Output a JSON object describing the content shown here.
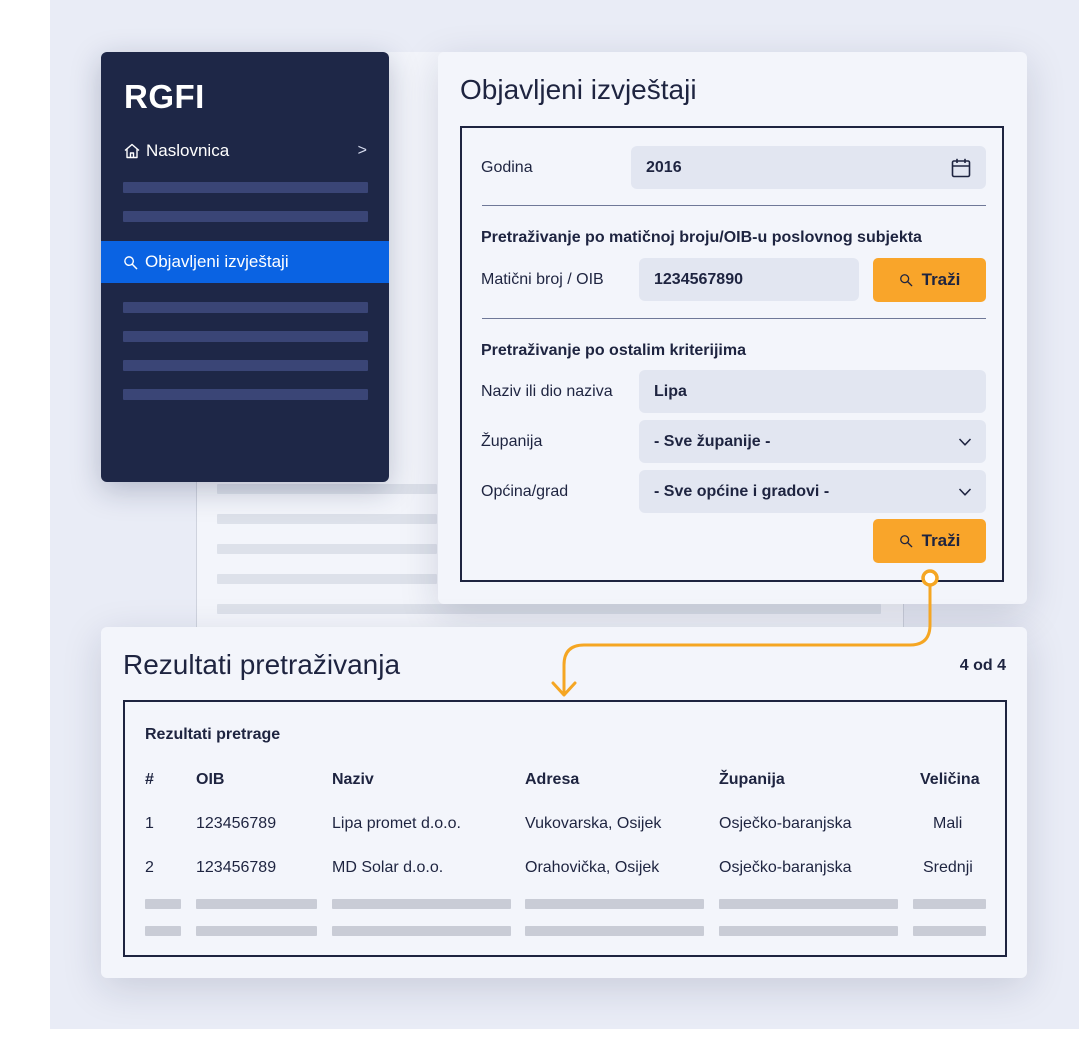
{
  "sidebar": {
    "brand": "RGFI",
    "home_label": "Naslovnica",
    "home_chevron": ">",
    "active_label": "Objavljeni izvještaji"
  },
  "search": {
    "title": "Objavljeni izvještaji",
    "year_label": "Godina",
    "year_value": "2016",
    "section_oib": "Pretraživanje po matičnoj broju/OIB-u poslovnog subjekta",
    "oib_label": "Matični broj / OIB",
    "oib_value": "1234567890",
    "search_button": "Traži",
    "section_other": "Pretraživanje po ostalim kriterijima",
    "name_label": "Naziv ili dio naziva",
    "name_value": "Lipa",
    "county_label": "Županija",
    "county_value": "- Sve županije -",
    "city_label": "Općina/grad",
    "city_value": "- Sve općine i gradovi -",
    "search_button_2": "Traži"
  },
  "results": {
    "title": "Rezultati pretraživanja",
    "count": "4 od 4",
    "caption": "Rezultati pretrage",
    "columns": [
      "#",
      "OIB",
      "Naziv",
      "Adresa",
      "Županija",
      "Veličina"
    ],
    "rows": [
      [
        "1",
        "123456789",
        "Lipa promet d.o.o.",
        "Vukovarska, Osijek",
        "Osječko-baranjska",
        "Mali"
      ],
      [
        "2",
        "123456789",
        "MD Solar d.o.o.",
        "Orahovička, Osijek",
        "Osječko-baranjska",
        "Srednji"
      ]
    ]
  },
  "colors": {
    "sidebar_bg": "#1e2747",
    "active_nav": "#0a63e3",
    "accent_button": "#f9a52a",
    "connector": "#f5a623"
  },
  "icons": {
    "home": "home-icon",
    "search": "search-icon",
    "calendar": "calendar-icon",
    "dropdown": "chevron-down-icon"
  }
}
